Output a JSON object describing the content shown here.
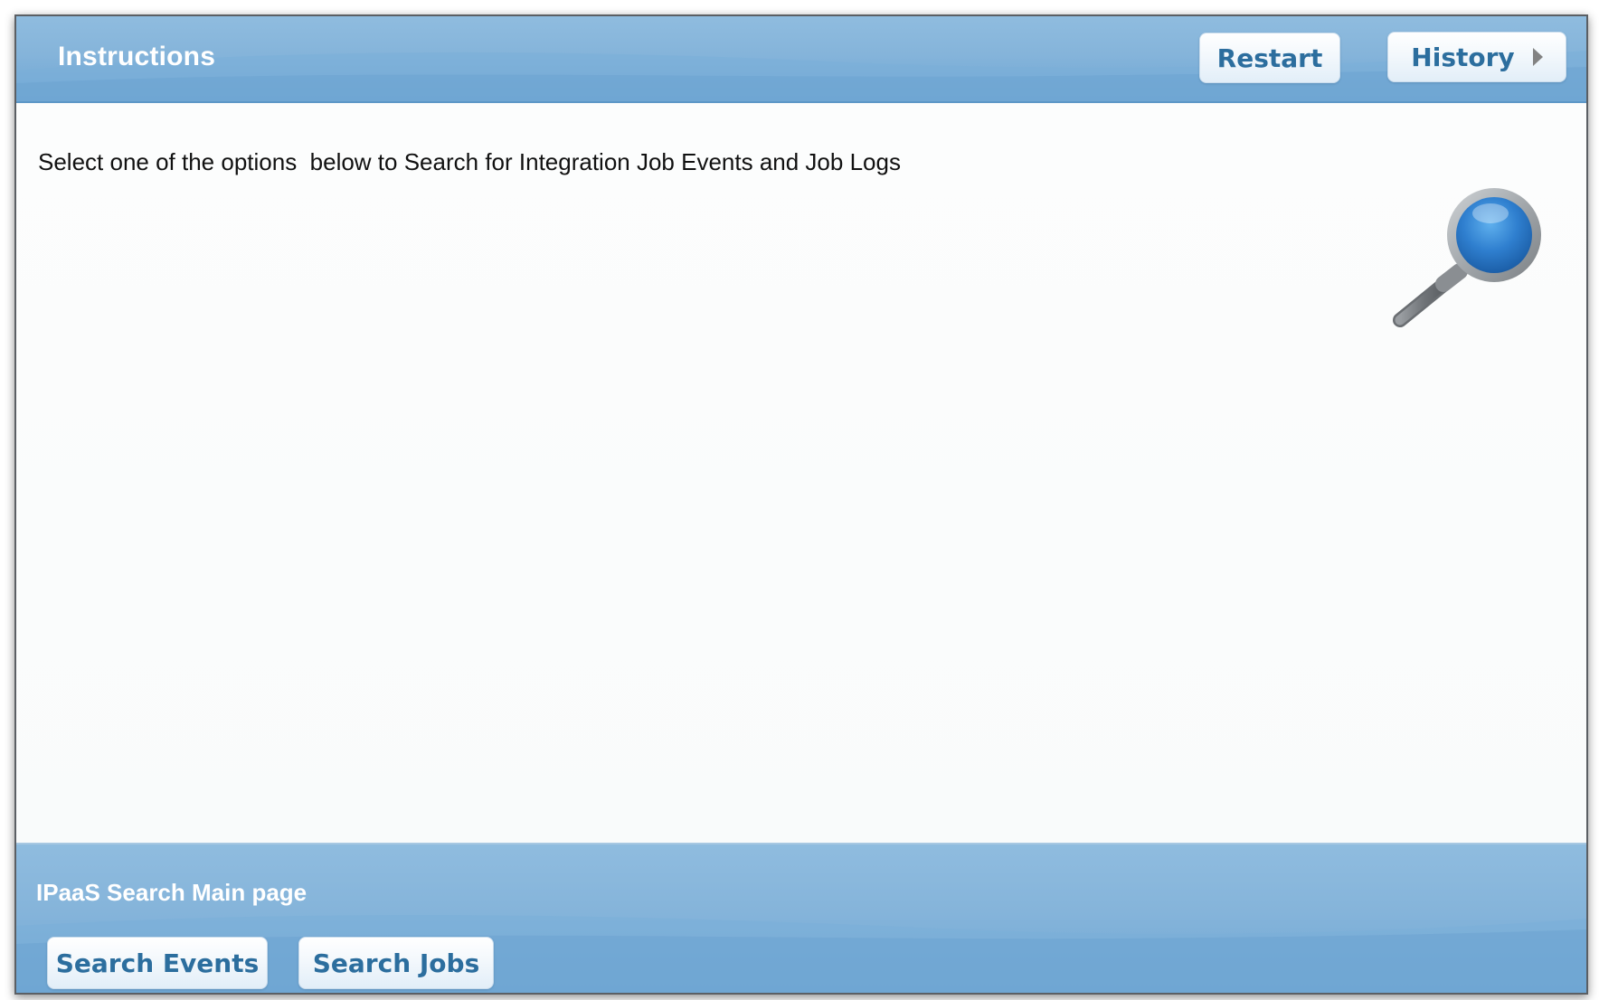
{
  "header": {
    "title": "Instructions",
    "restart_label": "Restart",
    "history_label": "History"
  },
  "content": {
    "instruction": "Select one of the options  below to Search for Integration Job Events and Job Logs"
  },
  "footer": {
    "title": "IPaaS Search Main page",
    "search_events_label": "Search Events",
    "search_jobs_label": "Search Jobs"
  },
  "icons": {
    "magnifier": "magnifying-glass-icon",
    "history_chevron": "chevron-right-icon"
  },
  "colors": {
    "bar_top": "#8fbcdf",
    "bar_bottom": "#6ea6d4",
    "button_text": "#2c6e9e",
    "lens_blue": "#2f7fcf"
  }
}
